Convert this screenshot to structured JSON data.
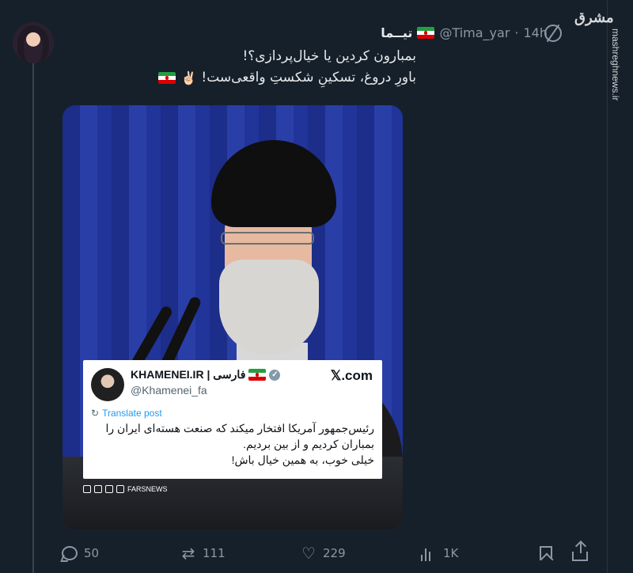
{
  "tweet": {
    "display_name": "تیــما",
    "handle": "@Tima_yar",
    "separator": "·",
    "time": "14h",
    "text_line1": "بمبارون کردین یا خیال‌پردازی؟!",
    "text_line2": "باورِ دروغ، تسکینِ شکستِ واقعی‌ست!",
    "emoji_victory": "✌🏻"
  },
  "watermark": {
    "logo_text": "مشرق",
    "site": "mashreghnews.ir"
  },
  "embedded_post": {
    "name": "KHAMENEI.IR | فارسی",
    "handle": "@Khamenei_fa",
    "verified_mark": "✓",
    "source": "𝕏.com",
    "translate_label": "Translate post",
    "body_line1": "رئیس‌جمهور آمریکا افتخار میکند که صنعت هسته‌ای ایران را",
    "body_line2": "بمباران کردیم و از بین بردیم.",
    "body_line3": "خیلی خوب، به همین خیال باش!"
  },
  "media_credit": {
    "text": "FARSNEWS"
  },
  "actions": {
    "replies": "50",
    "reposts": "111",
    "likes": "229",
    "views": "1K"
  },
  "colors": {
    "background": "#15202b",
    "text_primary": "#e7e9ea",
    "text_secondary": "#8b98a5",
    "link": "#1d9bf0"
  }
}
